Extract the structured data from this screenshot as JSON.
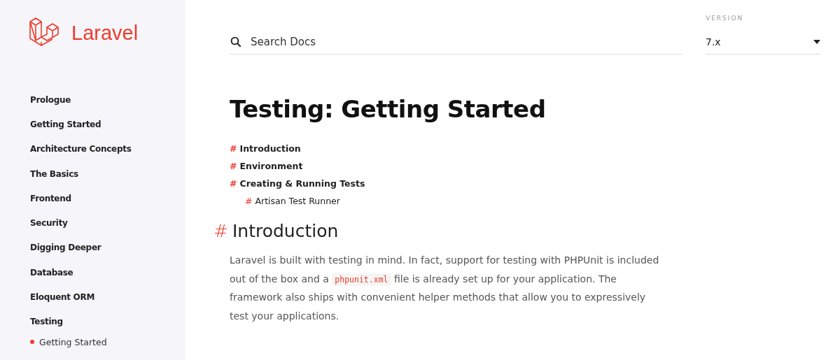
{
  "logo": {
    "wordmark": "Laravel"
  },
  "sidebar": {
    "items": [
      {
        "label": "Prologue"
      },
      {
        "label": "Getting Started"
      },
      {
        "label": "Architecture Concepts"
      },
      {
        "label": "The Basics"
      },
      {
        "label": "Frontend"
      },
      {
        "label": "Security"
      },
      {
        "label": "Digging Deeper"
      },
      {
        "label": "Database"
      },
      {
        "label": "Eloquent ORM"
      },
      {
        "label": "Testing",
        "children": [
          {
            "label": "Getting Started",
            "selected": true
          }
        ]
      }
    ]
  },
  "search": {
    "placeholder": "Search Docs"
  },
  "version": {
    "label": "VERSION",
    "value": "7.x"
  },
  "page": {
    "title": "Testing: Getting Started",
    "toc": [
      {
        "mark": "#",
        "label": "Introduction"
      },
      {
        "mark": "#",
        "label": "Environment"
      },
      {
        "mark": "#",
        "label": "Creating & Running Tests",
        "children": [
          {
            "mark": "#",
            "label": "Artisan Test Runner"
          }
        ]
      }
    ],
    "section": {
      "mark": "#",
      "heading": "Introduction",
      "paragraph": {
        "before": "Laravel is built with testing in mind. In fact, support for testing with PHPUnit is included out of the box and a ",
        "code": "phpunit.xml",
        "after": " file is already set up for your application. The framework also ships with convenient helper methods that allow you to expressively test your applications."
      }
    }
  }
}
